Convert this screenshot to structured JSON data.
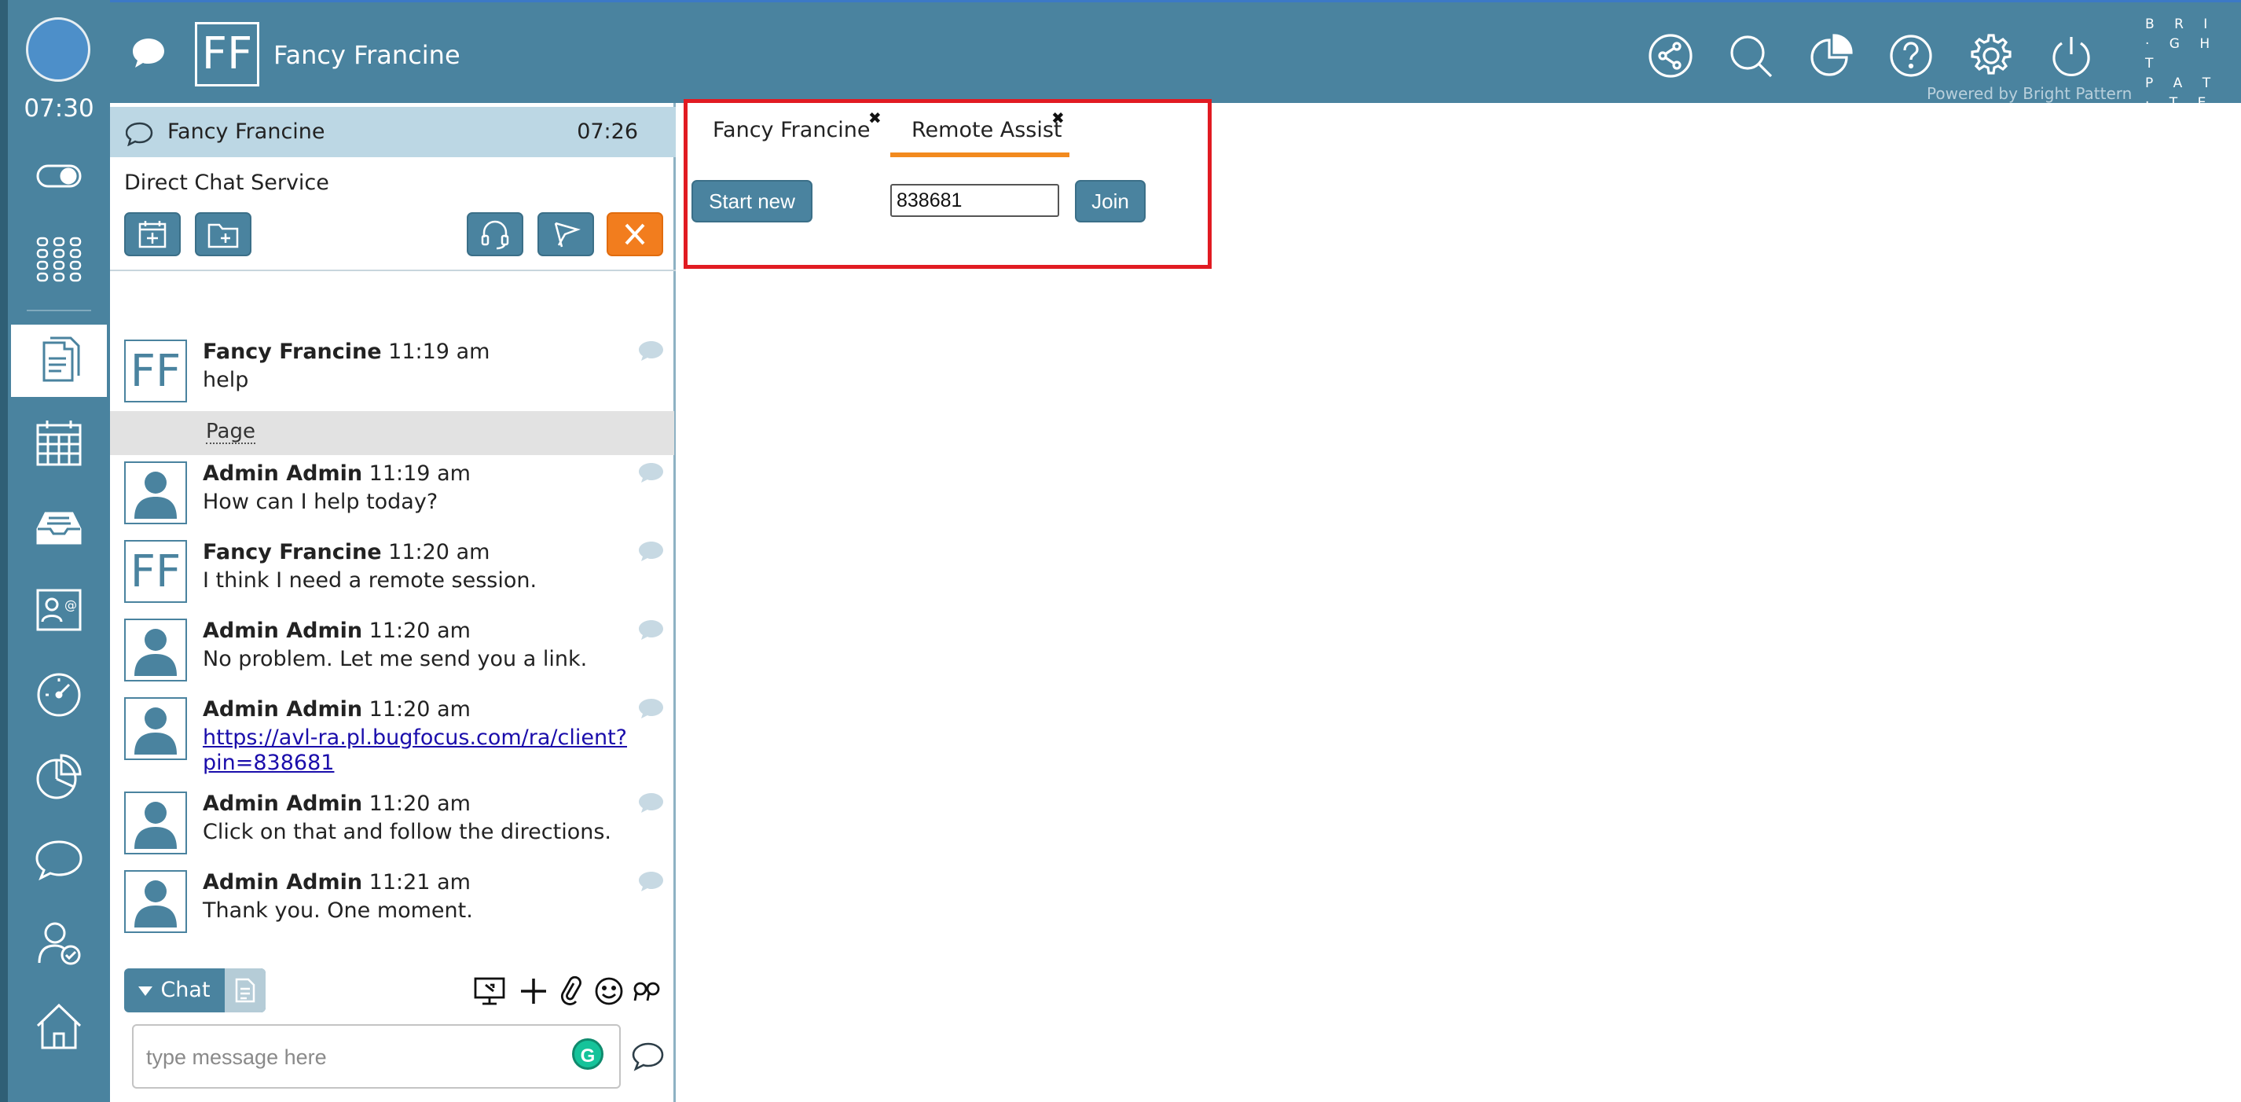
{
  "rail": {
    "clock": "07:30",
    "icons": [
      "status-toggle-icon",
      "dialpad-icon",
      "document-icon",
      "calendar-icon",
      "inbox-icon",
      "directory-icon",
      "dashboard-icon",
      "reports-icon",
      "chat-icon",
      "user-check-icon",
      "home-icon"
    ],
    "active_icon": "document-icon"
  },
  "topbar": {
    "initials": "FF",
    "name": "Fancy Francine",
    "icons": [
      "share-icon",
      "search-icon",
      "analytics-icon",
      "help-icon",
      "settings-icon",
      "power-icon"
    ],
    "brand": "BRI·GHT PAT·TERN",
    "brand_lines": [
      "B R I",
      "· G H T",
      "P A T",
      "· T E R N"
    ],
    "powered_by": "Powered by Bright Pattern"
  },
  "chat": {
    "header_name": "Fancy Francine",
    "header_time": "07:26",
    "service": "Direct Chat Service",
    "page_label": "Page",
    "messages": [
      {
        "author": "Fancy Francine",
        "time": "11:19 am",
        "text": "help",
        "avatar": "FF"
      },
      {
        "author": "Admin Admin",
        "time": "11:19 am",
        "text": "How can I help today?",
        "avatar": "person"
      },
      {
        "author": "Fancy Francine",
        "time": "11:20 am",
        "text": "I think I need a remote session.",
        "avatar": "FF"
      },
      {
        "author": "Admin Admin",
        "time": "11:20 am",
        "text": "No problem. Let me send you a link.",
        "avatar": "person"
      },
      {
        "author": "Admin Admin",
        "time": "11:20 am",
        "link_line1": "https://avl-ra.pl.bugfocus.com/ra/client?",
        "link_line2": "pin=838681",
        "avatar": "person"
      },
      {
        "author": "Admin Admin",
        "time": "11:20 am",
        "text": "Click on that and follow the directions.",
        "avatar": "person"
      },
      {
        "author": "Admin Admin",
        "time": "11:21 am",
        "text": "Thank you. One moment.",
        "avatar": "person"
      }
    ],
    "mode_label": "Chat",
    "composer_placeholder": "type message here",
    "grammarly_letter": "G"
  },
  "remote_assist": {
    "tabs": [
      {
        "label": "Fancy Francine",
        "close": "✖"
      },
      {
        "label": "Remote Assist",
        "close": "✖"
      }
    ],
    "active_tab": "Remote Assist",
    "start_new_label": "Start new",
    "pin_value": "838681",
    "join_label": "Join",
    "highlight_color": "#e11b22",
    "accent_color": "#f28a1e"
  },
  "colors": {
    "primary": "#4a839f",
    "header_bg": "#bcd7e4",
    "close_button": "#f27d1e"
  }
}
